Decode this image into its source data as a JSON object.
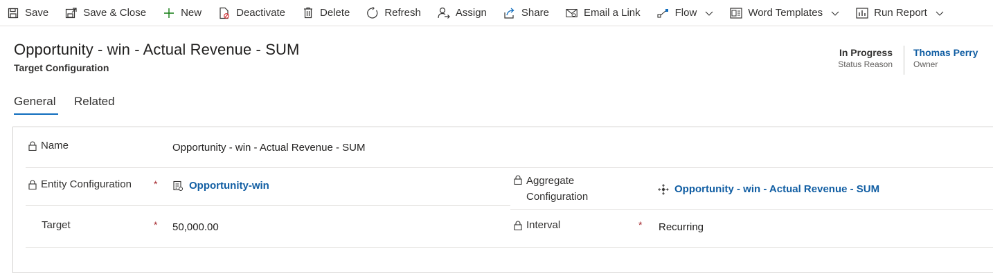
{
  "toolbar": {
    "items": [
      {
        "label": "Save",
        "icon": "save-icon"
      },
      {
        "label": "Save & Close",
        "icon": "save-close-icon"
      },
      {
        "label": "New",
        "icon": "plus-icon"
      },
      {
        "label": "Deactivate",
        "icon": "deactivate-icon"
      },
      {
        "label": "Delete",
        "icon": "trash-icon"
      },
      {
        "label": "Refresh",
        "icon": "refresh-icon"
      },
      {
        "label": "Assign",
        "icon": "assign-icon"
      },
      {
        "label": "Share",
        "icon": "share-icon"
      },
      {
        "label": "Email a Link",
        "icon": "email-link-icon"
      },
      {
        "label": "Flow",
        "icon": "flow-icon"
      },
      {
        "label": "Word Templates",
        "icon": "word-templates-icon"
      },
      {
        "label": "Run Report",
        "icon": "report-icon"
      }
    ]
  },
  "header": {
    "title": "Opportunity - win - Actual Revenue - SUM",
    "entity": "Target Configuration",
    "status_reason": {
      "value": "In Progress",
      "label": "Status Reason"
    },
    "owner": {
      "value": "Thomas Perry",
      "label": "Owner"
    }
  },
  "tabs": [
    {
      "label": "General",
      "selected": true
    },
    {
      "label": "Related",
      "selected": false
    }
  ],
  "form": {
    "name": {
      "label": "Name",
      "value": "Opportunity - win - Actual Revenue - SUM",
      "locked": true
    },
    "entity_configuration": {
      "label": "Entity Configuration",
      "required": "*",
      "value": "Opportunity-win",
      "locked": true
    },
    "aggregate_configuration": {
      "label_line1": "Aggregate",
      "label_line2": "Configuration",
      "value": "Opportunity - win - Actual Revenue - SUM",
      "locked": true
    },
    "target": {
      "label": "Target",
      "required": "*",
      "value": "50,000.00"
    },
    "interval": {
      "label": "Interval",
      "required": "*",
      "value": "Recurring",
      "locked": true
    }
  },
  "colors": {
    "accent": "#0f6cbd",
    "link": "#115ea3",
    "required": "#a4262c"
  }
}
